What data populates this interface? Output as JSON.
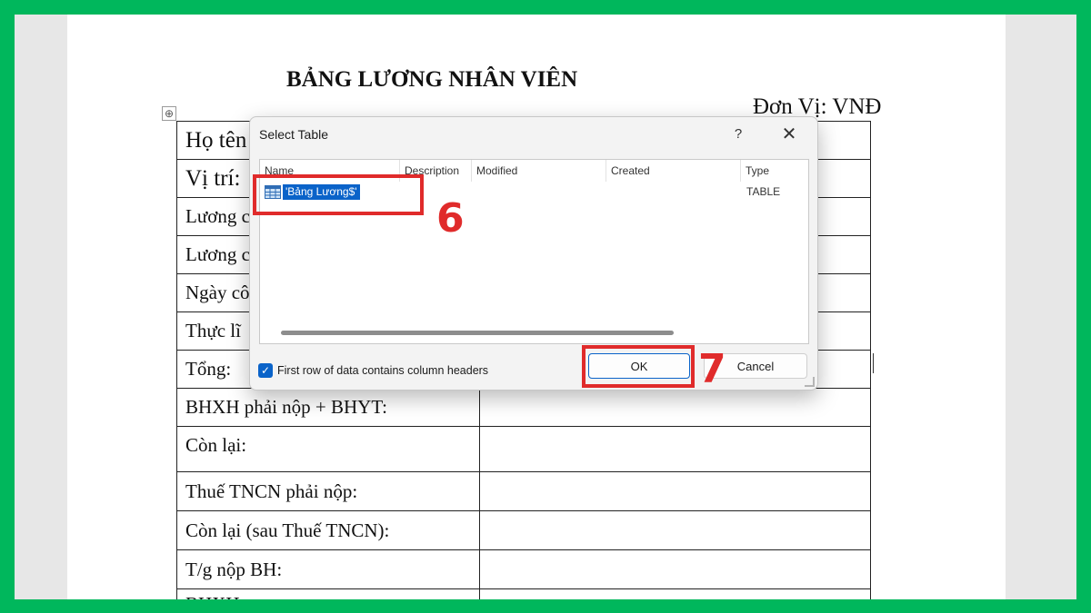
{
  "document": {
    "title": "BẢNG LƯƠNG NHÂN VIÊN",
    "unit": "Đơn Vị: VNĐ",
    "move_handle_glyph": "⊕",
    "rows": [
      {
        "label": "Họ tên"
      },
      {
        "label": "Vị trí:"
      },
      {
        "label": "Lương c"
      },
      {
        "label": "Lương c"
      },
      {
        "label": "Ngày cô"
      },
      {
        "label": "Thực lĩ"
      },
      {
        "label": "Tổng:"
      },
      {
        "label": "BHXH phải nộp + BHYT:"
      },
      {
        "label": "Còn lại:"
      },
      {
        "label": "Thuế TNCN phải nộp:"
      },
      {
        "label": "Còn lại (sau Thuế TNCN):"
      },
      {
        "label": "T/g nộp BH:"
      },
      {
        "label": "BHXH"
      }
    ]
  },
  "dialog": {
    "title": "Select Table",
    "help_glyph": "?",
    "close_glyph": "✕",
    "columns": [
      "Name",
      "Description",
      "Modified",
      "Created",
      "Type"
    ],
    "table_rows": [
      {
        "name": "'Bảng Lương$'",
        "type": "TABLE",
        "icon": "table-icon"
      }
    ],
    "checkbox": {
      "label": "First row of data contains column headers",
      "checked": true,
      "glyph": "✓"
    },
    "ok_label": "OK",
    "cancel_label": "Cancel"
  },
  "annotations": {
    "step_select": "6",
    "step_ok": "7",
    "color": "#e02b2b"
  }
}
